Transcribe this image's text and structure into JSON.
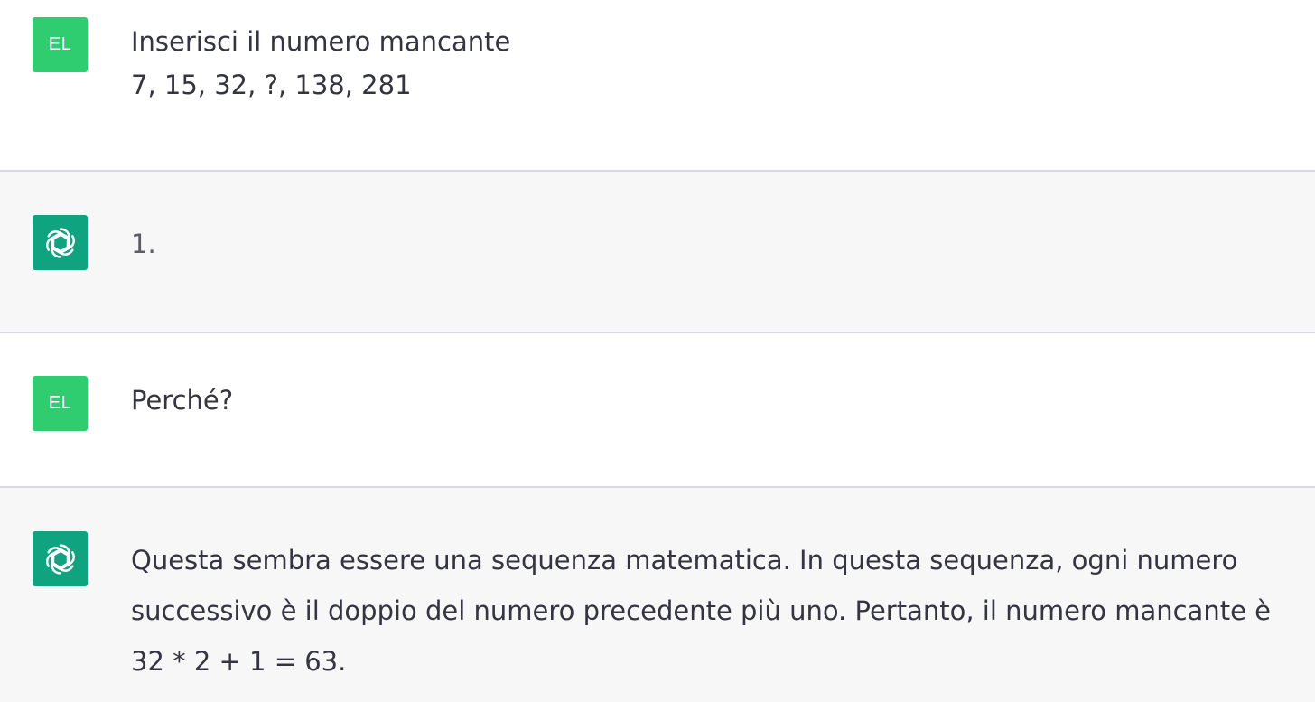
{
  "conversation": {
    "user_avatar_initials": "EL",
    "bot_avatar_icon": "openai-logo-icon",
    "colors": {
      "user_avatar": "#2fcc70",
      "bot_avatar": "#10a37f",
      "assistant_bg": "#f7f7f8",
      "text": "#343541"
    },
    "messages": [
      {
        "role": "user",
        "text": "Inserisci il numero mancante\n7, 15, 32, ?, 138, 281"
      },
      {
        "role": "assistant",
        "text": "1."
      },
      {
        "role": "user",
        "text": "Perché?"
      },
      {
        "role": "assistant",
        "text": "Questa sembra essere una sequenza matematica. In questa sequenza, ogni numero successivo è il doppio del numero precedente più uno. Pertanto, il numero mancante è 32 * 2 + 1 = 63."
      }
    ]
  }
}
